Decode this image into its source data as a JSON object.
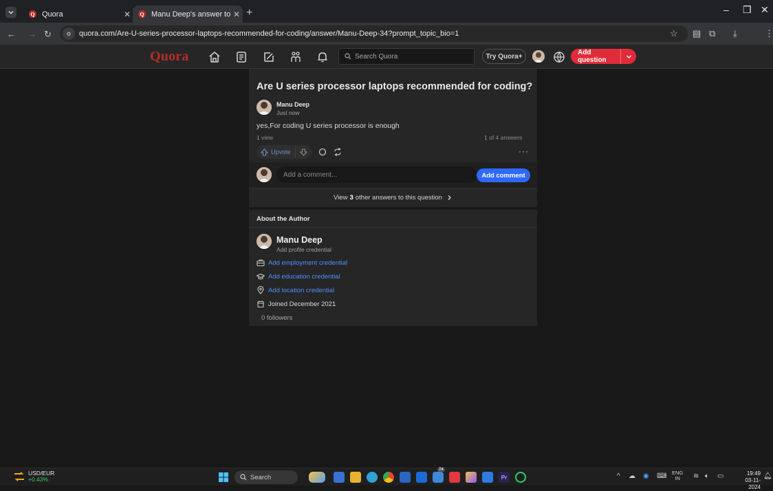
{
  "browser": {
    "tabs": [
      {
        "title": "Quora",
        "active": false
      },
      {
        "title": "Manu Deep's answer to Are U s...",
        "active": true
      }
    ],
    "url": "quora.com/Are-U-series-processor-laptops-recommended-for-coding/answer/Manu-Deep-34?prompt_topic_bio=1"
  },
  "header": {
    "logo": "Quora",
    "search_placeholder": "Search Quora",
    "try_plus": "Try Quora+",
    "add_question": "Add question"
  },
  "answer": {
    "question_title": "Are U series processor laptops recommended for coding?",
    "author_name": "Manu Deep",
    "time": "Just now",
    "text": "yes,For coding U series processor is enough",
    "views": "1 view",
    "answer_count": "1 of 4 answers",
    "upvote_label": "Upvote",
    "more": "···"
  },
  "comment": {
    "placeholder": "Add a comment...",
    "button": "Add comment"
  },
  "view_other": {
    "prefix": "View",
    "count": "3",
    "suffix": "other answers to this question"
  },
  "about": {
    "heading": "About the Author",
    "name": "Manu Deep",
    "credential_prompt": "Add profile credential",
    "employment": "Add employment credential",
    "education": "Add education credential",
    "location": "Add location credential",
    "joined": "Joined December 2021",
    "followers": "0 followers"
  },
  "taskbar": {
    "ticker_name": "USD/EUR",
    "ticker_change": "+0.43%",
    "search": "Search",
    "lang_top": "ENG",
    "lang_bottom": "IN",
    "time": "19:49",
    "date": "03-11-2024",
    "notification_badge": "74"
  },
  "colors": {
    "quora_red": "#b92b27",
    "add_question_red": "#e02c38",
    "link_blue": "#4e8fff",
    "button_blue": "#2e69ff"
  }
}
